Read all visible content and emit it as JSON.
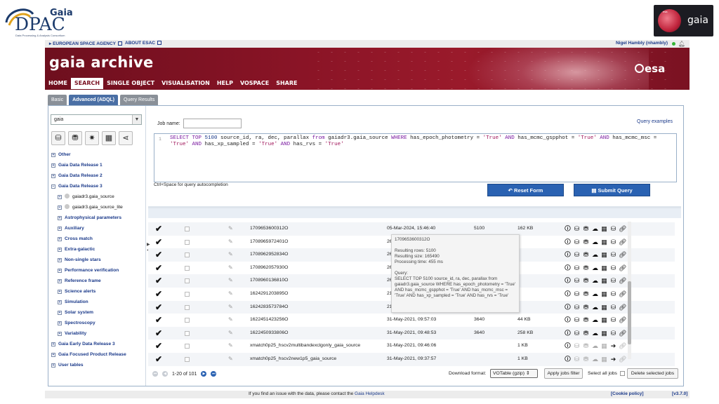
{
  "logos": {
    "dpac_small": "Gaia",
    "dpac_main": "DPAC",
    "dpac_sub": "Data Processing & Analysis Consortium",
    "esa_tiny": "esa",
    "gaia_word": "gaia"
  },
  "topstrip": {
    "agency_link": "EUROPEAN SPACE AGENCY",
    "about_link": "ABOUT ESAC",
    "user": "Nigel Hambly (nhambly)"
  },
  "banner": {
    "title": "gaia archive",
    "esa": "esa"
  },
  "nav": [
    "HOME",
    "SEARCH",
    "SINGLE OBJECT",
    "VISUALISATION",
    "HELP",
    "VOSPACE",
    "SHARE"
  ],
  "subtabs": [
    "Basic",
    "Advanced (ADQL)",
    "Query Results"
  ],
  "left": {
    "schema": "gaia",
    "tree": [
      {
        "label": "Other",
        "level": 1
      },
      {
        "label": "Gaia Data Release 1",
        "level": 1
      },
      {
        "label": "Gaia Data Release 2",
        "level": 1
      },
      {
        "label": "Gaia Data Release 3",
        "level": 1,
        "open": true
      },
      {
        "label": "gaiadr3.gaia_source",
        "level": 2
      },
      {
        "label": "gaiadr3.gaia_source_lite",
        "level": 2
      },
      {
        "label": "Astrophysical parameters",
        "level": 1,
        "indent": true
      },
      {
        "label": "Auxiliary",
        "level": 1,
        "indent": true
      },
      {
        "label": "Cross match",
        "level": 1,
        "indent": true
      },
      {
        "label": "Extra-galactic",
        "level": 1,
        "indent": true
      },
      {
        "label": "Non-single stars",
        "level": 1,
        "indent": true
      },
      {
        "label": "Performance verification",
        "level": 1,
        "indent": true
      },
      {
        "label": "Reference frame",
        "level": 1,
        "indent": true
      },
      {
        "label": "Science alerts",
        "level": 1,
        "indent": true
      },
      {
        "label": "Simulation",
        "level": 1,
        "indent": true
      },
      {
        "label": "Solar system",
        "level": 1,
        "indent": true
      },
      {
        "label": "Spectroscopy",
        "level": 1,
        "indent": true
      },
      {
        "label": "Variability",
        "level": 1,
        "indent": true
      },
      {
        "label": "Gaia Early Data Release 3",
        "level": 1
      },
      {
        "label": "Gaia Focused Product Release",
        "level": 1
      },
      {
        "label": "User tables",
        "level": 1
      }
    ]
  },
  "query": {
    "job_name_label": "Job name:",
    "examples_link": "Query examples",
    "line_number": "1",
    "autocomplete_hint": "Ctrl+Space for query autocompletion",
    "reset_label": "Reset Form",
    "submit_label": "Submit Query"
  },
  "jobs": [
    {
      "id": "1709653600312O",
      "date": "05-Mar-2024, 15:46:40",
      "rows": "5100",
      "size": "162 KB"
    },
    {
      "id": "1708965972401O",
      "date": "26-Feb-2024, 16:46:12",
      "rows": "",
      "size": ""
    },
    {
      "id": "1708962952834O",
      "date": "26-Feb-2024, 15:55:52",
      "rows": "",
      "size": ""
    },
    {
      "id": "1708962057930O",
      "date": "26-Feb-2024, 15:40:57",
      "rows": "",
      "size": ""
    },
    {
      "id": "1708960136810O",
      "date": "26-Feb-2024, 15:08:56",
      "rows": "",
      "size": ""
    },
    {
      "id": "1624291203895O",
      "date": "21-Jun-2021, 17:00:03",
      "rows": "",
      "size": ""
    },
    {
      "id": "1624283573784O",
      "date": "21-Jun-2021, 14:52:53",
      "rows": "",
      "size": ""
    },
    {
      "id": "1622451423256O",
      "date": "31-May-2021, 09:57:03",
      "rows": "3640",
      "size": "44 KB"
    },
    {
      "id": "1622450933806O",
      "date": "31-May-2021, 09:48:53",
      "rows": "3640",
      "size": "258 KB"
    },
    {
      "id": "xmatch0p25_hscv2multibandexclgonly_gaia_source",
      "date": "31-May-2021, 09:46:06",
      "rows": "",
      "size": "1 KB"
    },
    {
      "id": "xmatch0p25_hscv2new1p5_gaia_source",
      "date": "31-May-2021, 09:37:57",
      "rows": "",
      "size": "1 KB"
    }
  ],
  "tooltip": {
    "job": "1709653600312O",
    "rows": "Resulting rows: 5100",
    "size": "Resulting size: 165490",
    "time": "Processing time: 455 ms",
    "query_label": "Query:",
    "query_text": "SELECT TOP 5100 source_id, ra, dec, parallax from gaiadr3.gaia_source WHERE has_epoch_photometry = 'True' AND has_mcmc_gspphot = 'True' AND has_mcmc_msc = 'True' AND has_xp_sampled = 'True' AND has_rvs = 'True'"
  },
  "bottom": {
    "pager": "1-20 of 101",
    "download_label": "Download format:",
    "download_format": "VOTable (gzip)",
    "apply_label": "Apply jobs filter",
    "select_all_label": "Select all jobs",
    "delete_label": "Delete selected jobs"
  },
  "footer": {
    "text": "If you find an issue with the data, please contact the",
    "link": "Gaia Helpdesk",
    "cookie": "[Cookie policy]",
    "version": "[v3.7.0]"
  }
}
